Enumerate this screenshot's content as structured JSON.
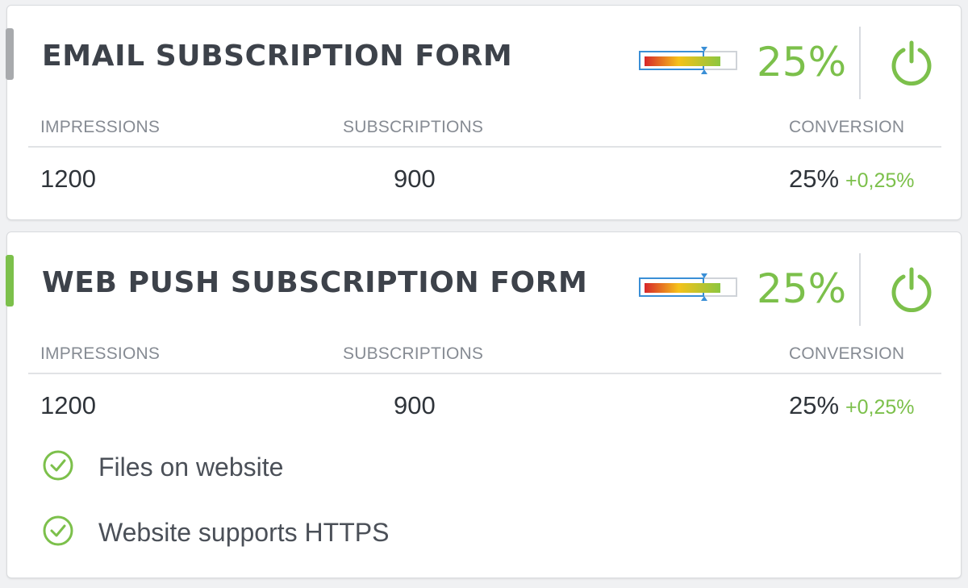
{
  "colors": {
    "green": "#7cc04b",
    "grey_accent": "#a8aaad",
    "title": "#3d424a",
    "meter_border": "#3a8fd6"
  },
  "cards": [
    {
      "title": "EMAIL SUBSCRIPTION FORM",
      "status": "inactive",
      "meter_level": 0.25,
      "percent": "25%",
      "power_icon": "power-icon",
      "columns": [
        "IMPRESSIONS",
        "SUBSCRIPTIONS",
        "CONVERSION"
      ],
      "values": {
        "impressions": "1200",
        "subscriptions": "900",
        "conversion": "25%",
        "conversion_delta": "+0,25%"
      }
    },
    {
      "title": "WEB PUSH SUBSCRIPTION FORM",
      "status": "active",
      "meter_level": 0.25,
      "percent": "25%",
      "power_icon": "power-icon",
      "columns": [
        "IMPRESSIONS",
        "SUBSCRIPTIONS",
        "CONVERSION"
      ],
      "values": {
        "impressions": "1200",
        "subscriptions": "900",
        "conversion": "25%",
        "conversion_delta": "+0,25%"
      },
      "checks": [
        {
          "label": "Files on website",
          "icon": "check-circle-icon"
        },
        {
          "label": "Website supports HTTPS",
          "icon": "check-circle-icon"
        }
      ]
    }
  ]
}
